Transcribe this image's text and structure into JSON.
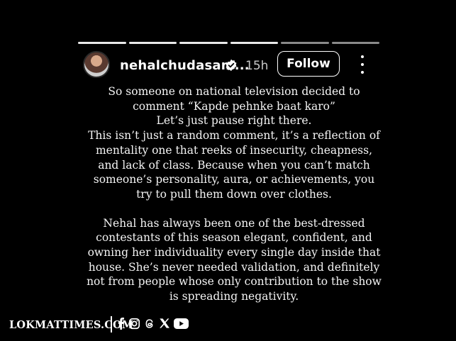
{
  "story": {
    "progress_segments": 6,
    "active_segment": 4
  },
  "header": {
    "username": "nehalchudasam...",
    "time": "15h",
    "follow_label": "Follow"
  },
  "post": {
    "lines_para1": [
      "So someone on national television decided to",
      "comment “Kapde pehnke baat karo”",
      "Let’s just pause right there.",
      "This isn’t just a random comment, it’s a reflection of",
      "mentality one that reeks of insecurity, cheapness,",
      "and lack of class. Because when you can’t match",
      "someone’s personality, aura, or achievements, you",
      "try to pull them down over clothes."
    ],
    "lines_para2": [
      "Nehal has always been one of the best-dressed",
      "contestants of this season elegant, confident, and",
      "owning her individuality every single day inside that",
      "house. She’s never needed validation, and definitely",
      "not from people whose only contribution to the show",
      "is spreading negativity."
    ]
  },
  "footer": {
    "brand": "LOKMATTIMES.COM",
    "social_icons": [
      "facebook-icon",
      "instagram-icon",
      "threads-icon",
      "x-icon",
      "youtube-icon"
    ]
  }
}
